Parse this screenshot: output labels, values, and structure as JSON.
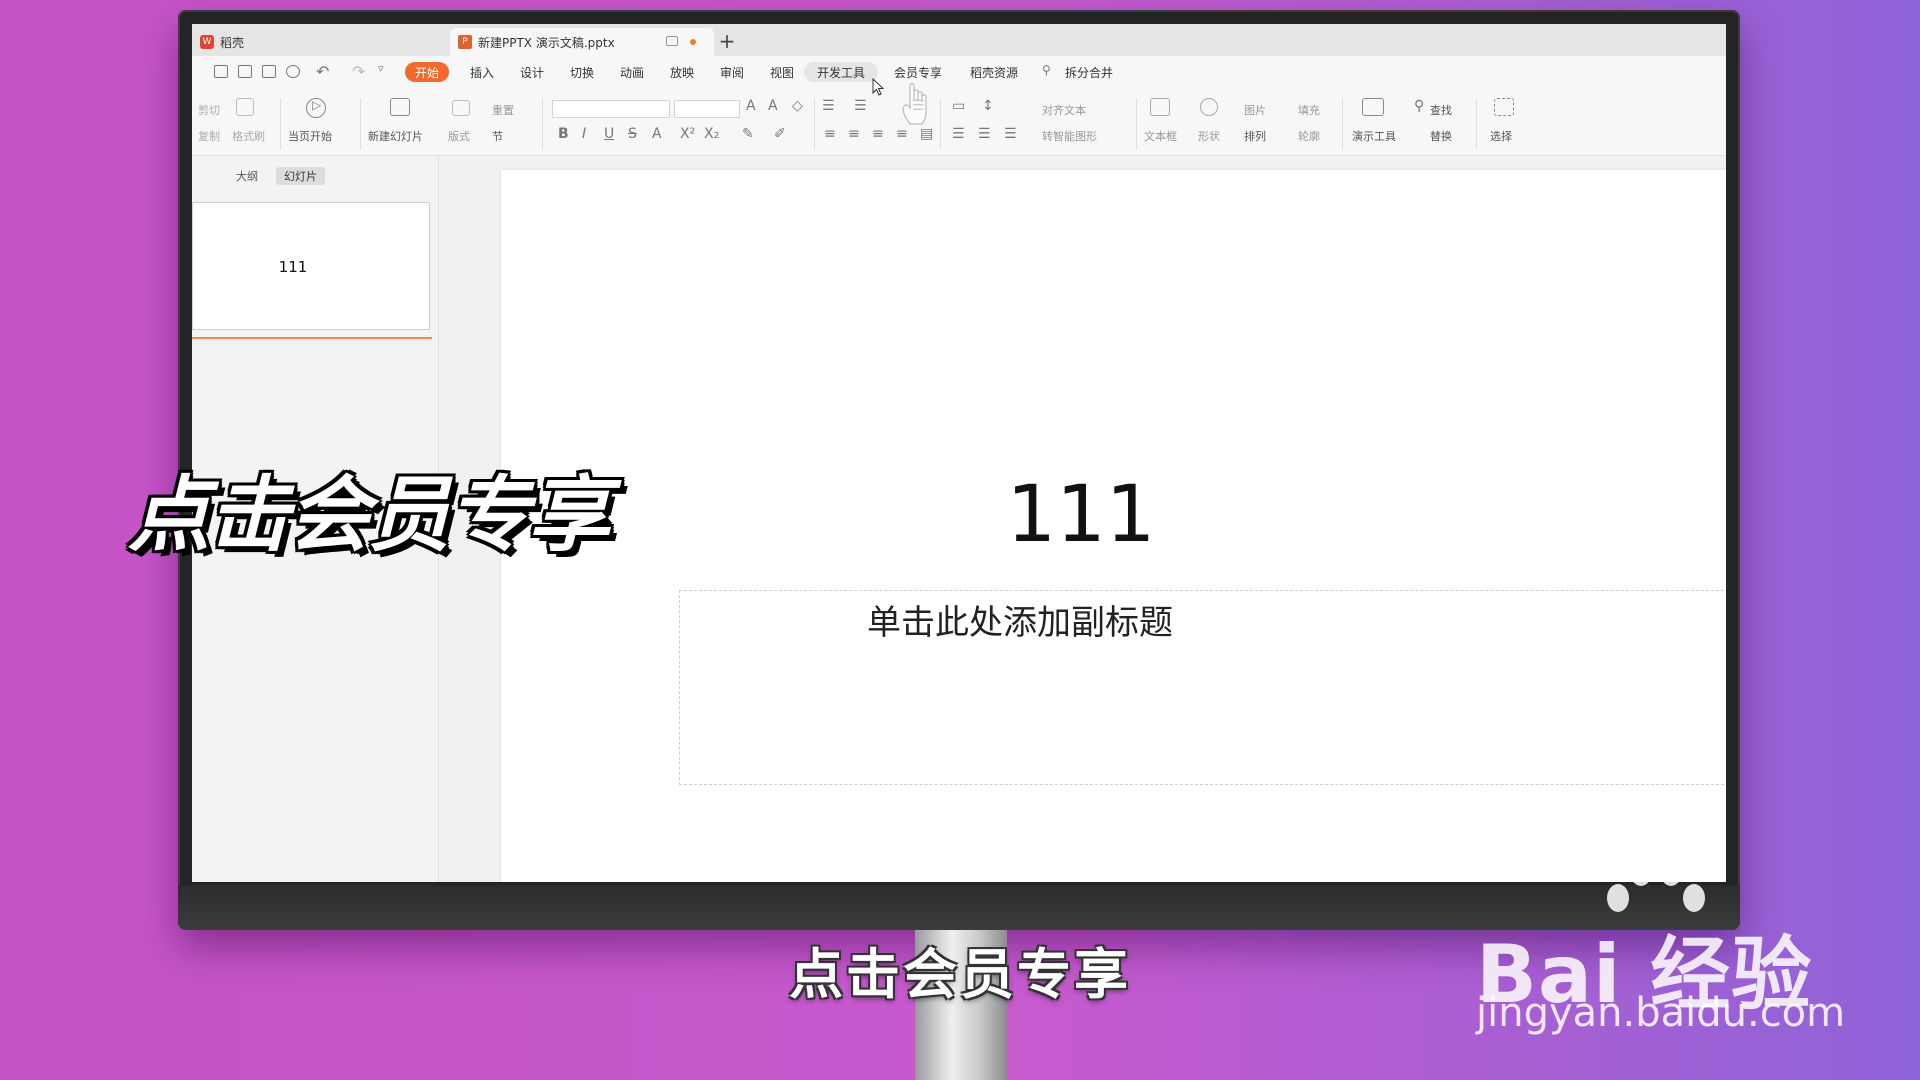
{
  "tabs": {
    "home_label": "稻壳",
    "doc_label": "新建PPTX 演示文稿.pptx",
    "add": "+"
  },
  "menu": {
    "items": [
      "开始",
      "插入",
      "设计",
      "切换",
      "动画",
      "放映",
      "审阅",
      "视图",
      "开发工具",
      "会员专享",
      "稻壳资源"
    ],
    "search_label": "拆分合并",
    "active_index": 0,
    "accent": "#ef6a2c"
  },
  "ribbon": {
    "cut": "剪切",
    "copy": "复制",
    "format_painter": "格式刷",
    "play_from_current": "当页开始",
    "new_slide": "新建幻灯片",
    "layout": "版式",
    "reset": "重置",
    "section": "节",
    "align_text": "对齐文本",
    "convert_smartart": "转智能图形",
    "text_box": "文本框",
    "shape": "形状",
    "picture": "图片",
    "arrange": "排列",
    "fill": "填充",
    "outline": "轮廓",
    "presentation_tools": "演示工具",
    "find": "查找",
    "replace": "替换",
    "select": "选择"
  },
  "left_panel": {
    "tab_outline": "大纲",
    "tab_slides": "幻灯片",
    "thumb_text": "111"
  },
  "slide": {
    "title": "111",
    "subtitle_placeholder": "单击此处添加副标题"
  },
  "overlay": {
    "big_caption": "点击会员专享",
    "subtitle_caption": "点击会员专享"
  },
  "watermark": {
    "brand": "Bai  经验",
    "url": "jingyan.baidu.com"
  }
}
